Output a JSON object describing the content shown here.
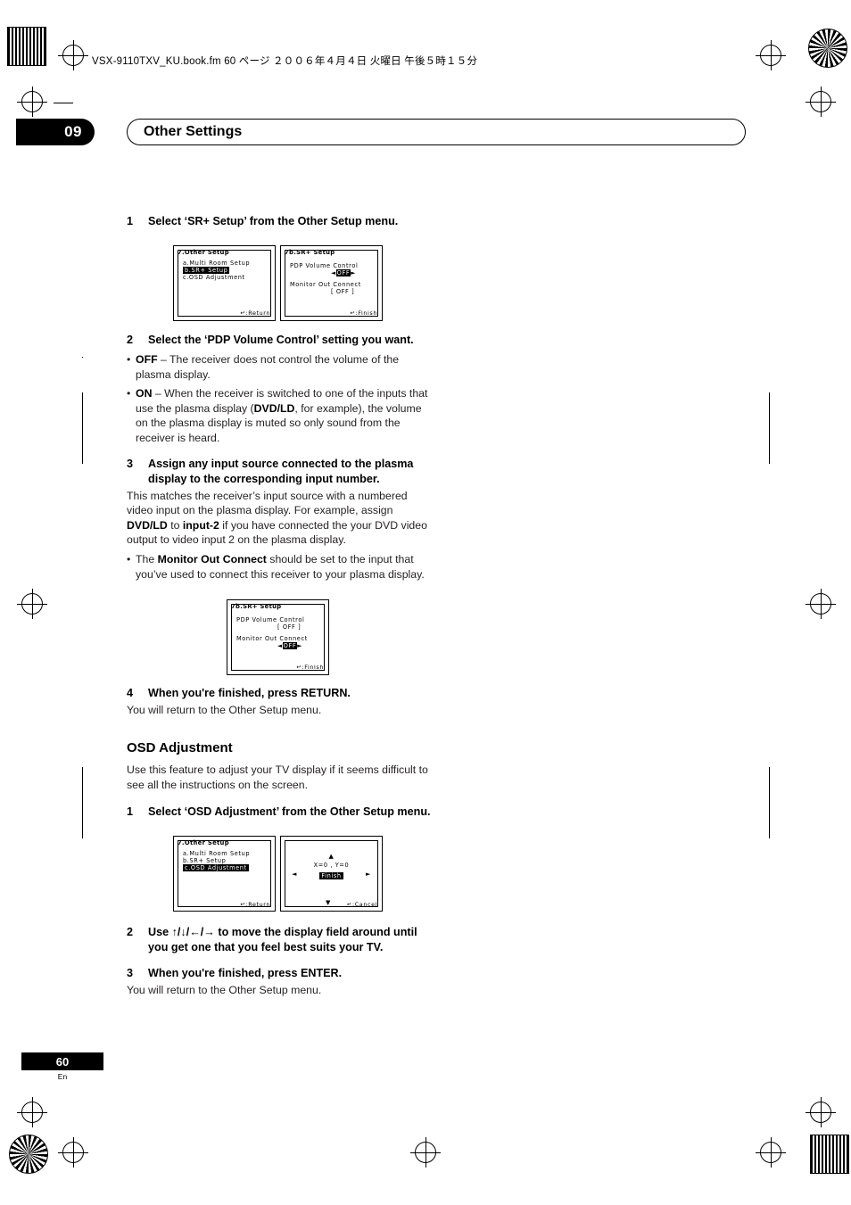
{
  "document": {
    "file_info": "VSX-9110TXV_KU.book.fm  60 ページ  ２００６年４月４日  火曜日  午後５時１５分",
    "chapter_number": "09",
    "chapter_title": "Other Settings",
    "page_number": "60",
    "page_language": "En"
  },
  "sr_plus": {
    "step1": {
      "num": "1",
      "text": "Select ‘SR+ Setup’ from the Other Setup menu."
    },
    "step2": {
      "num": "2",
      "text": "Select the ‘PDP Volume Control’ setting you want."
    },
    "step2_bullets": [
      {
        "bold": "OFF",
        "text": " – The receiver does not control the volume of the plasma display."
      },
      {
        "bold": "ON",
        "text": " – When the receiver is switched to one of the inputs that use the plasma display (DVD/LD, for example), the volume on the plasma display is muted so only sound from the receiver is heard."
      }
    ],
    "step3": {
      "num": "3",
      "text": "Assign any input source connected to the plasma display to the corresponding input number."
    },
    "step3_para": "This matches the receiver’s input source with a numbered video input on the plasma display. For example, assign DVD/LD to input-2 if you have connected the your DVD video output to video input 2 on the plasma display.",
    "step3_bullet": {
      "text_pre": "The ",
      "bold": "Monitor Out Connect",
      "text_post": " should be set to the input that you’ve used to connect this receiver to your plasma display."
    },
    "step4": {
      "num": "4",
      "text": "When you're finished, press RETURN."
    },
    "step4_para": "You will return to the Other Setup menu."
  },
  "osd_screens": {
    "other_setup_1": {
      "title": "7.Other  Setup",
      "items": [
        "a.Multi Room Setup",
        "b.SR+  Setup",
        "c.OSD  Adjustment"
      ],
      "highlight_index": 1,
      "footer": "↵:Return"
    },
    "sr_plus_setup_1": {
      "title": "7b.SR+  Setup",
      "label1": "PDP  Volume  Control",
      "value1": "◄ OFF ►",
      "label2": "Monitor  Out  Connect",
      "value2": "[  OFF  ]",
      "footer": "↵:Finish"
    },
    "sr_plus_setup_2": {
      "title": "7b.SR+  Setup",
      "label1": "PDP  Volume  Control",
      "value1": "[  OFF  ]",
      "label2": "Monitor  Out  Connect",
      "value2": "◄ OFF ►",
      "footer": "↵:Finish"
    },
    "other_setup_2": {
      "title": "7.Other  Setup",
      "items": [
        "a.Multi Room Setup",
        "b.SR+  Setup",
        "c.OSD  Adjustment"
      ],
      "highlight_index": 2,
      "footer": "↵:Return"
    },
    "osd_adjust": {
      "coords": "X=0 , Y=0",
      "finish": "Finish",
      "cancel": "↵:Cancel",
      "up_arrow": "▲",
      "down_arrow": "▼",
      "left_arrow": "◄",
      "right_arrow": "►"
    }
  },
  "osd_adjustment": {
    "heading": "OSD Adjustment",
    "intro": "Use this feature to adjust your TV display if it seems difficult to see all the instructions on the screen.",
    "step1": {
      "num": "1",
      "text": "Select ‘OSD Adjustment’ from the Other Setup menu."
    },
    "step2": {
      "num": "2",
      "text_pre": "Use ",
      "arrows": "↑/↓/←/→",
      "text_post": " to move the display field around until you get one that you feel best suits your TV."
    },
    "step3": {
      "num": "3",
      "text": "When you're finished, press ENTER."
    },
    "step3_para": "You will return to the Other Setup menu."
  }
}
